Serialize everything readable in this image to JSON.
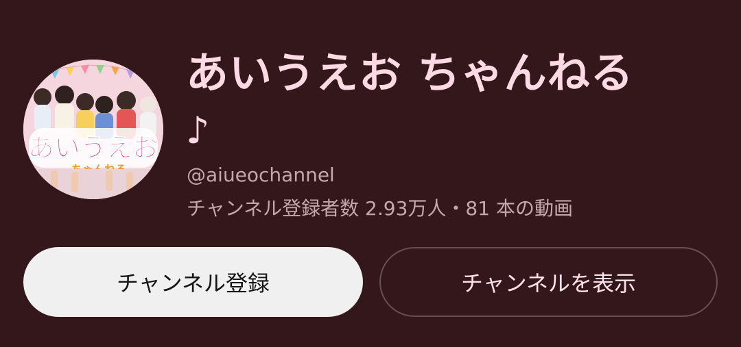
{
  "channel": {
    "name": "あいうえお ちゃんねる",
    "name_suffix": "♪",
    "handle": "@aiueochannel",
    "subscribers": "チャンネル登録者数 2.93万人",
    "separator": "・",
    "videos": "81 本の動画",
    "avatar_logo": "あいうえお",
    "avatar_logo_sub": "ちゃんねる"
  },
  "buttons": {
    "subscribe_label": "チャンネル登録",
    "view_label": "チャンネルを表示"
  },
  "colors": {
    "background": "#33171a",
    "title": "#ffd9e4",
    "meta_text": "#c4a8ae",
    "subscribe_bg": "#f1f0f0",
    "view_border": "#6c4d52"
  }
}
